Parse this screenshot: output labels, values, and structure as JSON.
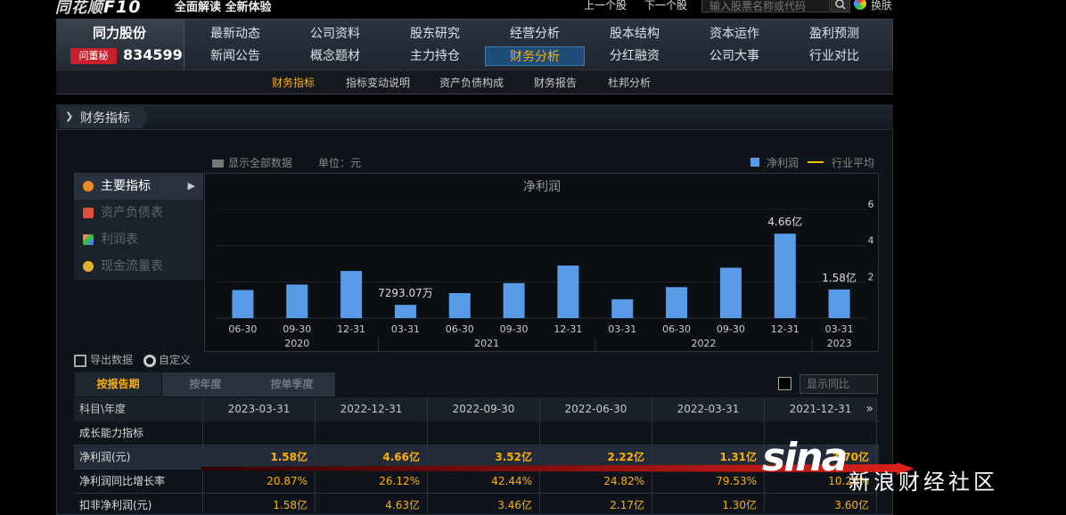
{
  "topbar": {
    "logo_text": "同花顺",
    "logo_f10": "F10",
    "slogan": "全面解读 全新体验",
    "prev_stock": "上一个股",
    "next_stock": "下一个股",
    "search_placeholder": "输入股票名称或代码",
    "skin_label": "换肤"
  },
  "stock": {
    "name": "同力股份",
    "badge": "问董秘",
    "code": "834599"
  },
  "nav": {
    "row1": [
      "最新动态",
      "公司资料",
      "股东研究",
      "经营分析",
      "股本结构",
      "资本运作",
      "盈利预测"
    ],
    "row2": [
      "新闻公告",
      "概念题材",
      "主力持仓",
      "财务分析",
      "分红融资",
      "公司大事",
      "行业对比"
    ],
    "active": "财务分析"
  },
  "subnav": [
    "财务指标",
    "指标变动说明",
    "资产负债构成",
    "财务报告",
    "杜邦分析"
  ],
  "panel": {
    "title": "财务指标",
    "show_all": "显示全部数据",
    "unit": "单位：元",
    "legend_bar": "净利润",
    "legend_line": "行业平均"
  },
  "sidemenu": [
    "主要指标",
    "资产负债表",
    "利润表",
    "现金流量表"
  ],
  "chart_data": {
    "type": "bar",
    "title": "净利润",
    "categories": [
      "06-30",
      "09-30",
      "12-31",
      "03-31",
      "06-30",
      "09-30",
      "12-31",
      "03-31",
      "06-30",
      "09-30",
      "12-31",
      "03-31"
    ],
    "years": [
      {
        "label": "2020",
        "from": 0,
        "to": 2
      },
      {
        "label": "2021",
        "from": 3,
        "to": 6
      },
      {
        "label": "2022",
        "from": 7,
        "to": 10
      },
      {
        "label": "2023",
        "from": 11,
        "to": 11
      }
    ],
    "values": [
      1.55,
      1.85,
      2.6,
      0.7293,
      1.38,
      1.93,
      2.9,
      1.04,
      1.71,
      2.78,
      4.66,
      1.58
    ],
    "unit": "亿",
    "data_labels": {
      "3": "7293.07万",
      "10": "4.66亿",
      "11": "1.58亿"
    },
    "ylim": [
      0,
      6
    ],
    "yticks": [
      2,
      4,
      6
    ],
    "series_color": "#5a9be8"
  },
  "tools": {
    "export": "导出数据",
    "customize": "自定义"
  },
  "tabs": [
    "按报告期",
    "按年度",
    "按单季度"
  ],
  "toggle_yoy": "显示同比",
  "table": {
    "corner": "科目\\年度",
    "columns": [
      "2023-03-31",
      "2022-12-31",
      "2022-09-30",
      "2022-06-30",
      "2022-03-31",
      "2021-12-31"
    ],
    "rows": [
      {
        "label": "成长能力指标",
        "values": [
          "",
          "",
          "",
          "",
          "",
          ""
        ]
      },
      {
        "label": "净利润(元)",
        "values": [
          "1.58亿",
          "4.66亿",
          "3.52亿",
          "2.22亿",
          "1.31亿",
          "3.70亿"
        ]
      },
      {
        "label": "净利润同比增长率",
        "values": [
          "20.87%",
          "26.12%",
          "42.44%",
          "24.82%",
          "79.53%",
          "10.26%"
        ]
      },
      {
        "label": "扣非净利润(元)",
        "values": [
          "1.58亿",
          "4.63亿",
          "3.46亿",
          "2.17亿",
          "1.30亿",
          "3.60亿"
        ]
      }
    ]
  },
  "watermark": {
    "logo": "sina",
    "text": "新浪财经社区"
  }
}
